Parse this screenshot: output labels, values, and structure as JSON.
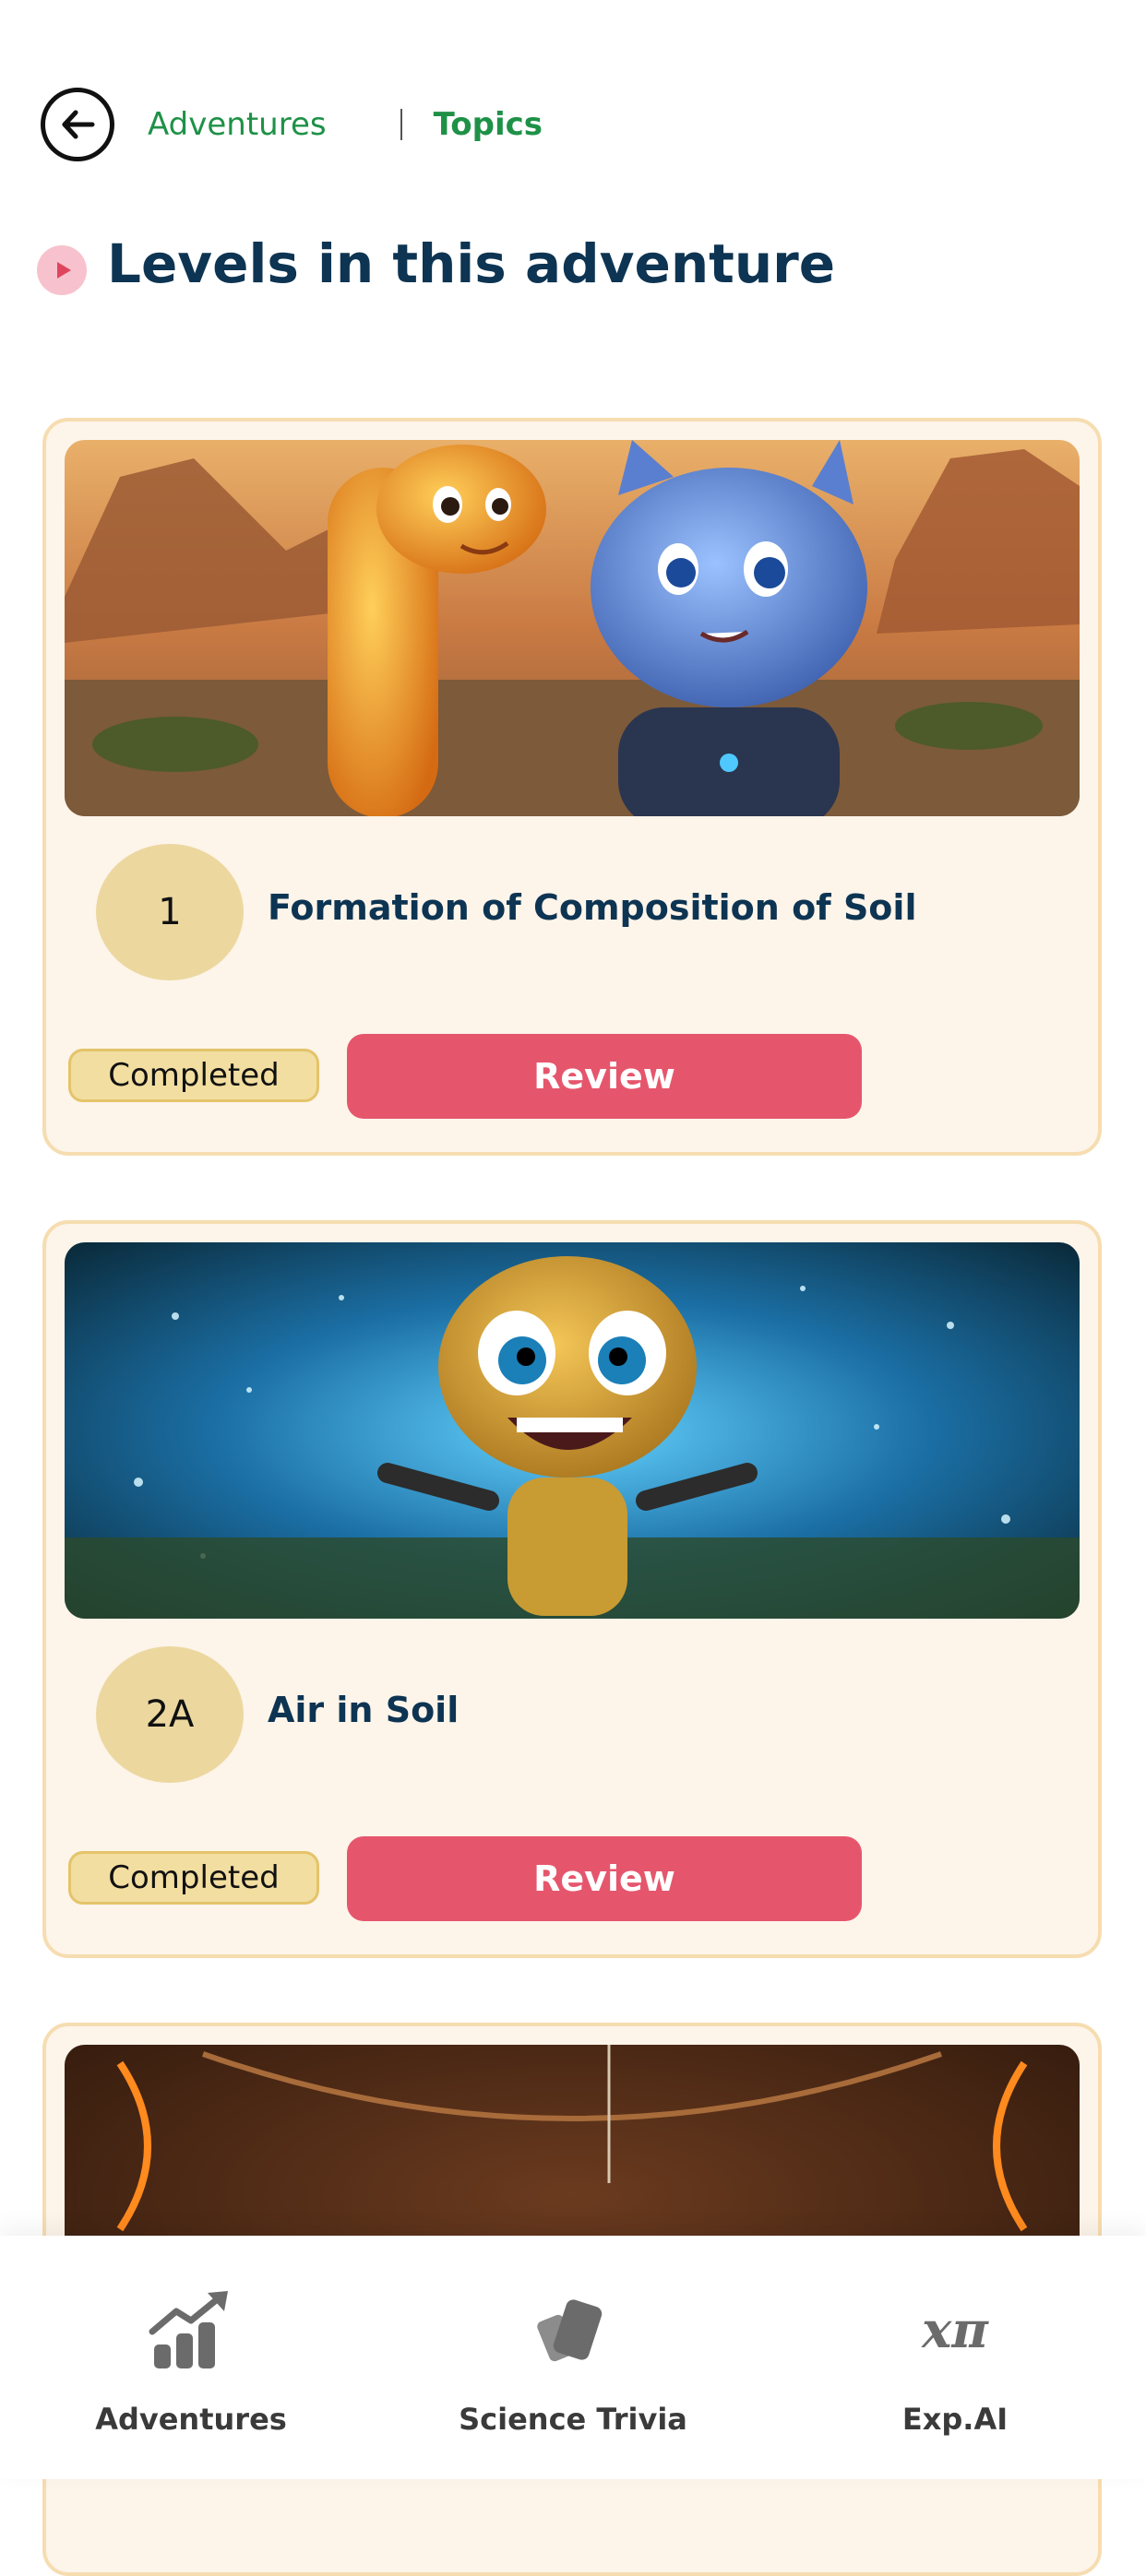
{
  "header": {
    "breadcrumb_adventures": "Adventures",
    "breadcrumb_topics": "Topics"
  },
  "page_title": "Levels in this adventure",
  "levels": [
    {
      "number": "1",
      "title": "Formation of Composition of Soil",
      "status": "Completed",
      "action": "Review"
    },
    {
      "number": "2A",
      "title": "Air in Soil",
      "status": "Completed",
      "action": "Review"
    }
  ],
  "bottom_nav": {
    "items": [
      {
        "label": "Adventures",
        "icon": "chart-growth-icon"
      },
      {
        "label": "Science Trivia",
        "icon": "cards-icon"
      },
      {
        "label": "Exp.AI",
        "icon": "x-pi-icon"
      }
    ],
    "xpi_glyph": "xπ"
  },
  "colors": {
    "accent_green": "#1e9147",
    "title_navy": "#0d3452",
    "review_pink": "#e5566d",
    "card_bg": "#fdf4ea",
    "badge_gold": "#f2dea0"
  }
}
